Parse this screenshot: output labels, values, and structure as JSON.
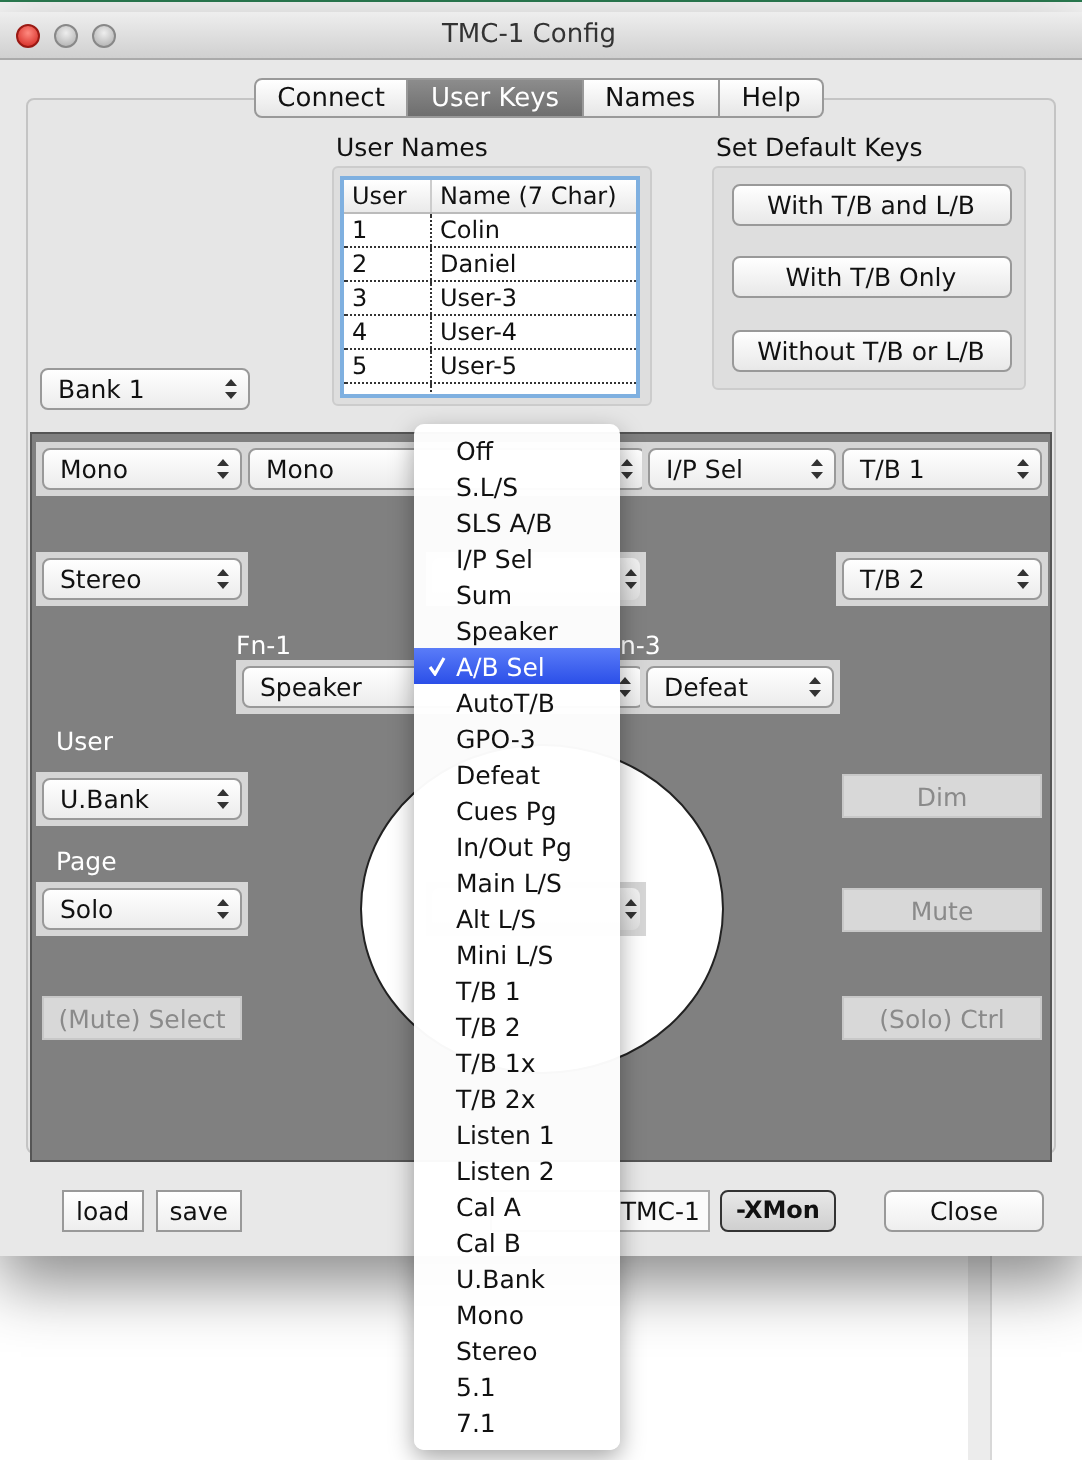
{
  "window": {
    "title": "TMC-1 Config"
  },
  "tabs": [
    {
      "label": "Connect",
      "selected": false
    },
    {
      "label": "User Keys",
      "selected": true
    },
    {
      "label": "Names",
      "selected": false
    },
    {
      "label": "Help",
      "selected": false
    }
  ],
  "bank_popup": {
    "value": "Bank 1"
  },
  "user_names": {
    "label": "User Names",
    "columns": [
      "User",
      "Name (7 Char)"
    ],
    "rows": [
      [
        "1",
        "Colin"
      ],
      [
        "2",
        "Daniel"
      ],
      [
        "3",
        "User-3"
      ],
      [
        "4",
        "User-4"
      ],
      [
        "5",
        "User-5"
      ]
    ]
  },
  "default_keys": {
    "label": "Set Default Keys",
    "buttons": [
      "With T/B and L/B",
      "With T/B Only",
      "Without T/B or L/B"
    ]
  },
  "panel": {
    "items": [
      {
        "kind": "popup",
        "value": "Mono"
      },
      {
        "kind": "popup",
        "value": "Mono"
      },
      {
        "kind": "popup",
        "value": "I/P Sel"
      },
      {
        "kind": "popup",
        "value": "T/B 1"
      },
      {
        "kind": "popup",
        "value": "Stereo"
      },
      {
        "kind": "stub"
      },
      {
        "kind": "popup",
        "value": "T/B 2"
      },
      {
        "kind": "label",
        "text": "Fn-1"
      },
      {
        "kind": "label",
        "text": "n-3"
      },
      {
        "kind": "popup",
        "value": "Speaker"
      },
      {
        "kind": "popup",
        "value": "Defeat"
      },
      {
        "kind": "label",
        "text": "User"
      },
      {
        "kind": "popup",
        "value": "U.Bank"
      },
      {
        "kind": "button",
        "label": "Dim",
        "disabled": true
      },
      {
        "kind": "label",
        "text": "Page"
      },
      {
        "kind": "popup",
        "value": "Solo"
      },
      {
        "kind": "stub"
      },
      {
        "kind": "button",
        "label": "Mute",
        "disabled": true
      },
      {
        "kind": "button",
        "label": "(Mute) Select",
        "disabled": true
      },
      {
        "kind": "button",
        "label": "(Solo) Ctrl",
        "disabled": true
      }
    ]
  },
  "bottom_buttons": [
    {
      "kind": "square",
      "label": "load"
    },
    {
      "kind": "square",
      "label": "save"
    },
    {
      "kind": "partial",
      "label": "TMC-1"
    },
    {
      "kind": "bold",
      "label": "-XMon"
    },
    {
      "kind": "rounded",
      "label": "Close"
    }
  ],
  "menu": {
    "items": [
      {
        "label": "Off",
        "selected": false
      },
      {
        "label": "S.L/S",
        "selected": false
      },
      {
        "label": "SLS A/B",
        "selected": false
      },
      {
        "label": "I/P Sel",
        "selected": false
      },
      {
        "label": "Sum",
        "selected": false
      },
      {
        "label": "Speaker",
        "selected": false
      },
      {
        "label": "A/B Sel",
        "selected": true
      },
      {
        "label": "AutoT/B",
        "selected": false
      },
      {
        "label": "GPO-3",
        "selected": false
      },
      {
        "label": "Defeat",
        "selected": false
      },
      {
        "label": "Cues Pg",
        "selected": false
      },
      {
        "label": "In/Out Pg",
        "selected": false
      },
      {
        "label": "Main L/S",
        "selected": false
      },
      {
        "label": "Alt L/S",
        "selected": false
      },
      {
        "label": "Mini L/S",
        "selected": false
      },
      {
        "label": "T/B 1",
        "selected": false
      },
      {
        "label": "T/B 2",
        "selected": false
      },
      {
        "label": "T/B 1x",
        "selected": false
      },
      {
        "label": "T/B 2x",
        "selected": false
      },
      {
        "label": "Listen 1",
        "selected": false
      },
      {
        "label": "Listen 2",
        "selected": false
      },
      {
        "label": "Cal A",
        "selected": false
      },
      {
        "label": "Cal B",
        "selected": false
      },
      {
        "label": "U.Bank",
        "selected": false
      },
      {
        "label": "Mono",
        "selected": false
      },
      {
        "label": "Stereo",
        "selected": false
      },
      {
        "label": "5.1",
        "selected": false
      },
      {
        "label": "7.1",
        "selected": false
      }
    ]
  }
}
